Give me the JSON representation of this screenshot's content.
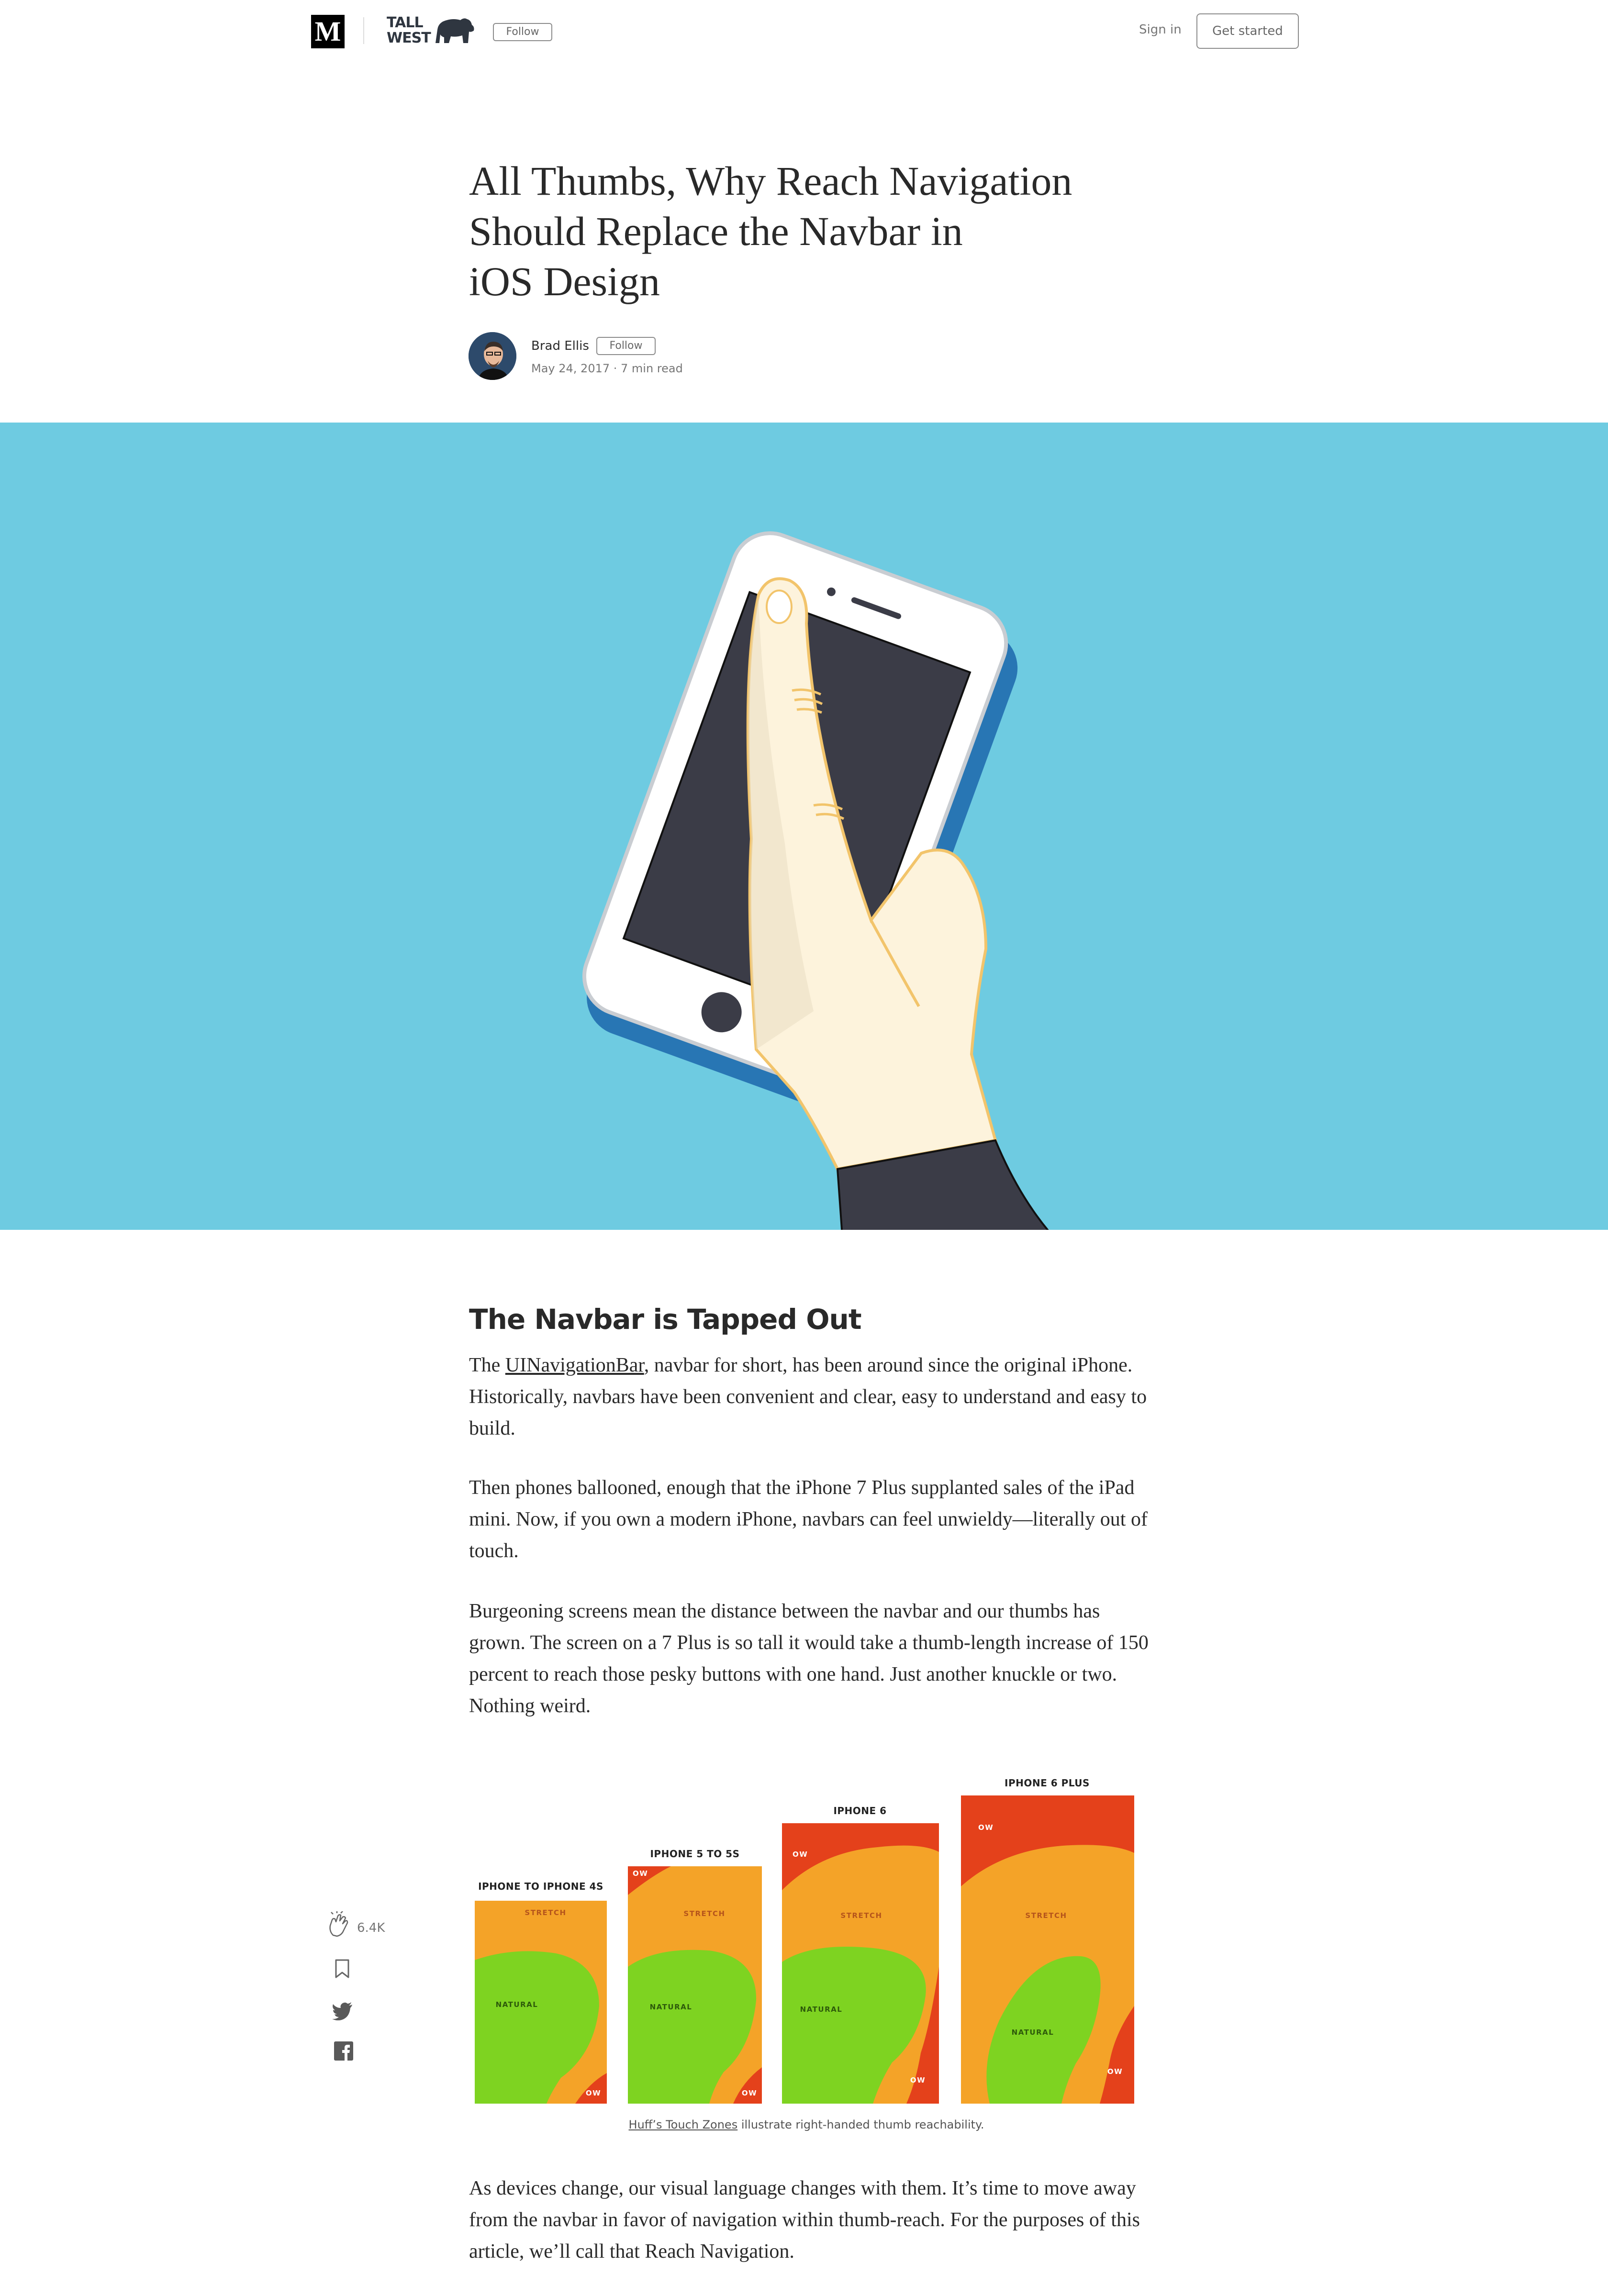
{
  "topbar": {
    "logo_letter": "M",
    "publication_line1": "TALL",
    "publication_line2": "WEST",
    "follow_label": "Follow",
    "signin_label": "Sign in",
    "get_started_label": "Get started"
  },
  "article": {
    "title_line1": "All Thumbs, Why Reach Navigation",
    "title_line2": "Should Replace the Navbar in",
    "title_line3": "iOS Design",
    "author": "Brad Ellis",
    "author_follow_label": "Follow",
    "date_read": "May 24, 2017 · 7 min read"
  },
  "section1": {
    "heading": "The Navbar is Tapped Out",
    "p1_pre": "The ",
    "p1_link": "UINavigationBar",
    "p1_post": ", navbar for short, has been around since the original iPhone. Historically, navbars have been convenient and clear, easy to understand and easy to build.",
    "p2": "Then phones ballooned, enough that the iPhone 7 Plus supplanted sales of the iPad mini. Now, if you own a modern iPhone, navbars can feel unwieldy—literally out of touch.",
    "p3": "Burgeoning screens mean the distance between the navbar and our thumbs has grown. The screen on a 7 Plus is so tall it would take a thumb-length increase of 150 percent to reach those pesky buttons with one hand. Just another knuckle or two. Nothing weird.",
    "p4": "As devices change, our visual language changes with them. It’s time to move away from the navbar in favor of navigation within thumb-reach. For the purposes of this article, we’ll call that Reach Navigation."
  },
  "share_rail": {
    "clap_count": "6.4K"
  },
  "figure": {
    "phones": [
      {
        "title": "IPHONE TO IPHONE 4S",
        "labels": [
          "STRETCH",
          "NATURAL",
          "OW"
        ]
      },
      {
        "title": "IPHONE 5 TO 5S",
        "labels": [
          "OW",
          "STRETCH",
          "NATURAL",
          "OW"
        ]
      },
      {
        "title": "IPHONE 6",
        "labels": [
          "OW",
          "STRETCH",
          "NATURAL",
          "OW"
        ]
      },
      {
        "title": "IPHONE 6 PLUS",
        "labels": [
          "OW",
          "STRETCH",
          "NATURAL",
          "OW"
        ]
      }
    ],
    "caption_link": "Huff’s Touch Zones",
    "caption_rest": " illustrate right-handed thumb reachability."
  },
  "colors": {
    "hero_bg": "#6ecbe1",
    "zone_ow": "#e4411b",
    "zone_stretch": "#f4a328",
    "zone_natural": "#7ed321"
  }
}
